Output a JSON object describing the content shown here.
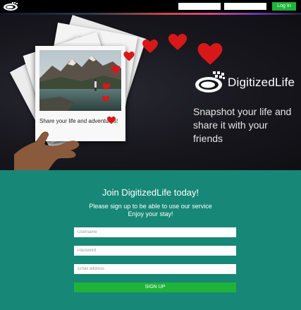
{
  "header": {
    "username_placeholder": "",
    "password_placeholder": "",
    "login_label": "Log In"
  },
  "hero": {
    "polaroid_caption": "Share your life and adventures!",
    "brand_name": "DigitizedLife",
    "tagline": "Snapshot your life and share it with your friends"
  },
  "signup": {
    "title": "Join DigitizedLife today!",
    "subtitle_line1": "Please sign up to be able to use our service",
    "subtitle_line2": "Enjoy your stay!",
    "username_placeholder": "Username",
    "password_placeholder": "Password",
    "email_placeholder": "Email address",
    "button_label": "SIGN UP"
  },
  "colors": {
    "accent_green": "#1fb33a",
    "section_teal": "#178777",
    "heart_red": "#d81818",
    "hero_dark": "#18171e"
  },
  "icons": [
    "logo-icon",
    "heart-icon",
    "camera-logo-icon"
  ]
}
